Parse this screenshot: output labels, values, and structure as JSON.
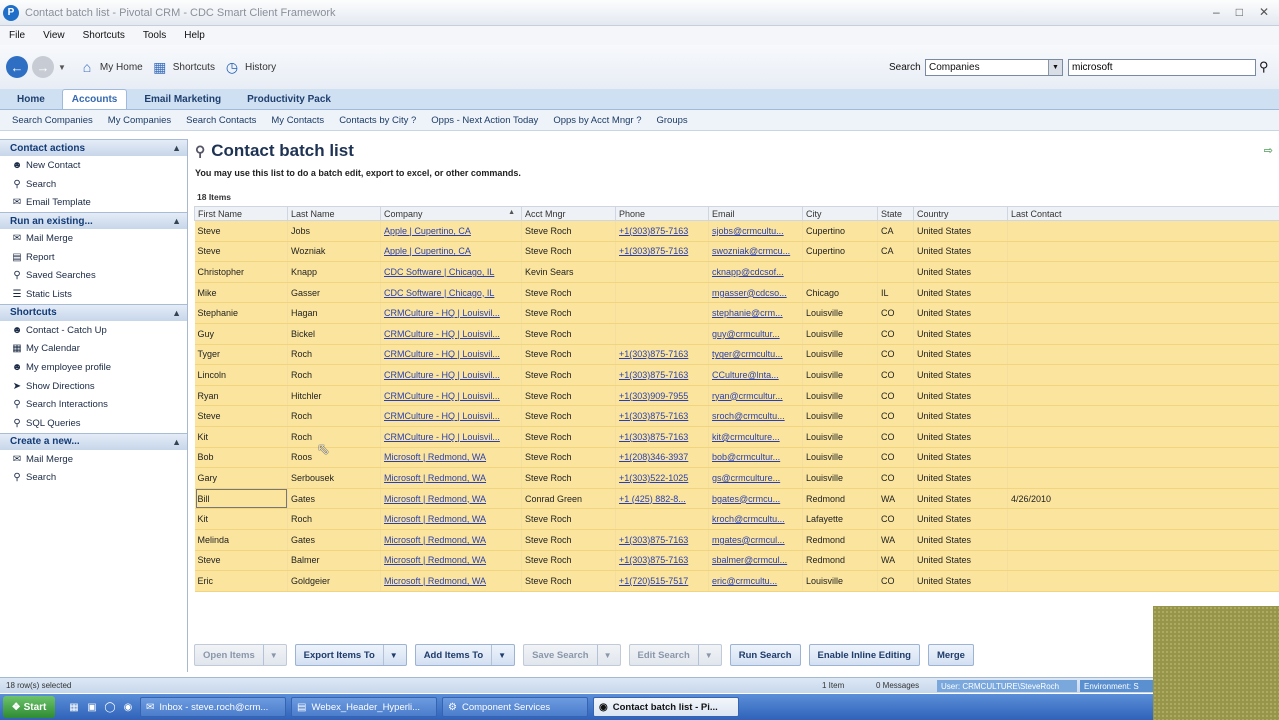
{
  "window": {
    "title": "Contact batch list - Pivotal CRM - CDC Smart Client Framework"
  },
  "menu": [
    "File",
    "View",
    "Shortcuts",
    "Tools",
    "Help"
  ],
  "toolbar": {
    "my_home": "My Home",
    "shortcuts": "Shortcuts",
    "history": "History"
  },
  "search": {
    "label": "Search",
    "type": "Companies",
    "value": "microsoft"
  },
  "tabs": [
    {
      "label": "Home",
      "active": false
    },
    {
      "label": "Accounts",
      "active": true
    },
    {
      "label": "Email Marketing",
      "active": false
    },
    {
      "label": "Productivity Pack",
      "active": false
    }
  ],
  "subnav": [
    "Search Companies",
    "My Companies",
    "Search Contacts",
    "My Contacts",
    "Contacts by City ?",
    "Opps - Next Action Today",
    "Opps by Acct Mngr ?",
    "Groups"
  ],
  "sidebar": {
    "sections": [
      {
        "title": "Contact actions",
        "items": [
          {
            "label": "New Contact",
            "icon": "new-contact-icon"
          },
          {
            "label": "Search",
            "icon": "search-icon"
          },
          {
            "label": "Email Template",
            "icon": "email-template-icon"
          }
        ]
      },
      {
        "title": "Run an existing...",
        "items": [
          {
            "label": "Mail Merge",
            "icon": "mail-merge-icon"
          },
          {
            "label": "Report",
            "icon": "report-icon"
          },
          {
            "label": "Saved Searches",
            "icon": "saved-searches-icon"
          },
          {
            "label": "Static Lists",
            "icon": "static-lists-icon"
          }
        ]
      },
      {
        "title": "Shortcuts",
        "items": [
          {
            "label": "Contact - Catch Up",
            "icon": "contact-icon"
          },
          {
            "label": "My Calendar",
            "icon": "calendar-icon"
          },
          {
            "label": "My employee profile",
            "icon": "employee-profile-icon"
          },
          {
            "label": "Show Directions",
            "icon": "directions-icon"
          },
          {
            "label": "Search Interactions",
            "icon": "search-interactions-icon"
          },
          {
            "label": "SQL Queries",
            "icon": "sql-queries-icon"
          }
        ]
      },
      {
        "title": "Create a new...",
        "items": [
          {
            "label": "Mail Merge",
            "icon": "mail-merge-icon"
          },
          {
            "label": "Search",
            "icon": "search-icon"
          }
        ]
      }
    ]
  },
  "main": {
    "title": "Contact batch list",
    "instructions": "You may use this list to do a batch edit, export to excel, or other commands.",
    "item_count": "18 Items",
    "columns": [
      "First Name",
      "Last Name",
      "Company",
      "Acct Mngr",
      "Phone",
      "Email",
      "City",
      "State",
      "Country",
      "Last Contact"
    ],
    "rows": [
      [
        "Steve",
        "Jobs",
        "Apple | Cupertino, CA",
        "Steve Roch",
        "+1(303)875-7163",
        "sjobs@crmcultu...",
        "Cupertino",
        "CA",
        "United States",
        ""
      ],
      [
        "Steve",
        "Wozniak",
        "Apple | Cupertino, CA",
        "Steve Roch",
        "+1(303)875-7163",
        "swozniak@crmcu...",
        "Cupertino",
        "CA",
        "United States",
        ""
      ],
      [
        "Christopher",
        "Knapp",
        "CDC Software | Chicago, IL",
        "Kevin Sears",
        "",
        "cknapp@cdcsof...",
        "",
        "",
        "United States",
        ""
      ],
      [
        "Mike",
        "Gasser",
        "CDC Software | Chicago, IL",
        "Steve Roch",
        "",
        "mgasser@cdcso...",
        "Chicago",
        "IL",
        "United States",
        ""
      ],
      [
        "Stephanie",
        "Hagan",
        "CRMCulture - HQ | Louisvil...",
        "Steve Roch",
        "",
        "stephanie@crm...",
        "Louisville",
        "CO",
        "United States",
        ""
      ],
      [
        "Guy",
        "Bickel",
        "CRMCulture - HQ | Louisvil...",
        "Steve Roch",
        "",
        "guy@crmcultur...",
        "Louisville",
        "CO",
        "United States",
        ""
      ],
      [
        "Tyger",
        "Roch",
        "CRMCulture - HQ | Louisvil...",
        "Steve Roch",
        "+1(303)875-7163",
        "tyger@crmcultu...",
        "Louisville",
        "CO",
        "United States",
        ""
      ],
      [
        "Lincoln",
        "Roch",
        "CRMCulture - HQ | Louisvil...",
        "Steve Roch",
        "+1(303)875-7163",
        "CCulture@lnta...",
        "Louisville",
        "CO",
        "United States",
        ""
      ],
      [
        "Ryan",
        "Hitchler",
        "CRMCulture - HQ | Louisvil...",
        "Steve Roch",
        "+1(303)909-7955",
        "ryan@crmcultur...",
        "Louisville",
        "CO",
        "United States",
        ""
      ],
      [
        "Steve",
        "Roch",
        "CRMCulture - HQ | Louisvil...",
        "Steve Roch",
        "+1(303)875-7163",
        "sroch@crmcultu...",
        "Louisville",
        "CO",
        "United States",
        ""
      ],
      [
        "Kit",
        "Roch",
        "CRMCulture - HQ | Louisvil...",
        "Steve Roch",
        "+1(303)875-7163",
        "kit@crmculture...",
        "Louisville",
        "CO",
        "United States",
        ""
      ],
      [
        "Bob",
        "Roos",
        "Microsoft | Redmond, WA",
        "Steve Roch",
        "+1(208)346-3937",
        "bob@crmcultur...",
        "Louisville",
        "CO",
        "United States",
        ""
      ],
      [
        "Gary",
        "Serbousek",
        "Microsoft | Redmond, WA",
        "Steve Roch",
        "+1(303)522-1025",
        "gs@crmculture...",
        "Louisville",
        "CO",
        "United States",
        ""
      ],
      [
        "Bill",
        "Gates",
        "Microsoft | Redmond, WA",
        "Conrad Green",
        "+1 (425) 882-8...",
        "bgates@crmcu...",
        "Redmond",
        "WA",
        "United States",
        "4/26/2010"
      ],
      [
        "Kit",
        "Roch",
        "Microsoft | Redmond, WA",
        "Steve Roch",
        "",
        "kroch@crmcultu...",
        "Lafayette",
        "CO",
        "United States",
        ""
      ],
      [
        "Melinda",
        "Gates",
        "Microsoft | Redmond, WA",
        "Steve Roch",
        "+1(303)875-7163",
        "mgates@crmcul...",
        "Redmond",
        "WA",
        "United States",
        ""
      ],
      [
        "Steve",
        "Balmer",
        "Microsoft | Redmond, WA",
        "Steve Roch",
        "+1(303)875-7163",
        "sbalmer@crmcul...",
        "Redmond",
        "WA",
        "United States",
        ""
      ],
      [
        "Eric",
        "Goldgeier",
        "Microsoft | Redmond, WA",
        "Steve Roch",
        "+1(720)515-7517",
        "eric@crmcultu...",
        "Louisville",
        "CO",
        "United States",
        ""
      ]
    ],
    "buttons": [
      {
        "label": "Open Items",
        "dropdown": true,
        "enabled": false,
        "name": "open-items-button"
      },
      {
        "label": "Export Items To",
        "dropdown": true,
        "enabled": true,
        "name": "export-items-button"
      },
      {
        "label": "Add Items To",
        "dropdown": true,
        "enabled": true,
        "name": "add-items-button"
      },
      {
        "label": "Save Search",
        "dropdown": true,
        "enabled": false,
        "name": "save-search-button"
      },
      {
        "label": "Edit Search",
        "dropdown": true,
        "enabled": false,
        "name": "edit-search-button"
      },
      {
        "label": "Run Search",
        "dropdown": false,
        "enabled": true,
        "name": "run-search-button"
      },
      {
        "label": "Enable Inline Editing",
        "dropdown": false,
        "enabled": true,
        "name": "enable-inline-editing-button"
      },
      {
        "label": "Merge",
        "dropdown": false,
        "enabled": true,
        "name": "merge-button"
      }
    ]
  },
  "status": {
    "left": "18 row(s) selected",
    "items": "1 Item",
    "messages": "0 Messages",
    "user": "User: CRMCULTURE\\SteveRoch",
    "environment": "Environment: S"
  },
  "taskbar": {
    "start": "Start",
    "tasks": [
      {
        "label": "Inbox - steve.roch@crm...",
        "active": false,
        "icon": "outlook-icon"
      },
      {
        "label": "Webex_Header_Hyperli...",
        "active": false,
        "icon": "pdf-icon"
      },
      {
        "label": "Component Services",
        "active": false,
        "icon": "component-services-icon"
      },
      {
        "label": "Contact batch list - Pi...",
        "active": true,
        "icon": "pivotal-icon"
      }
    ]
  }
}
